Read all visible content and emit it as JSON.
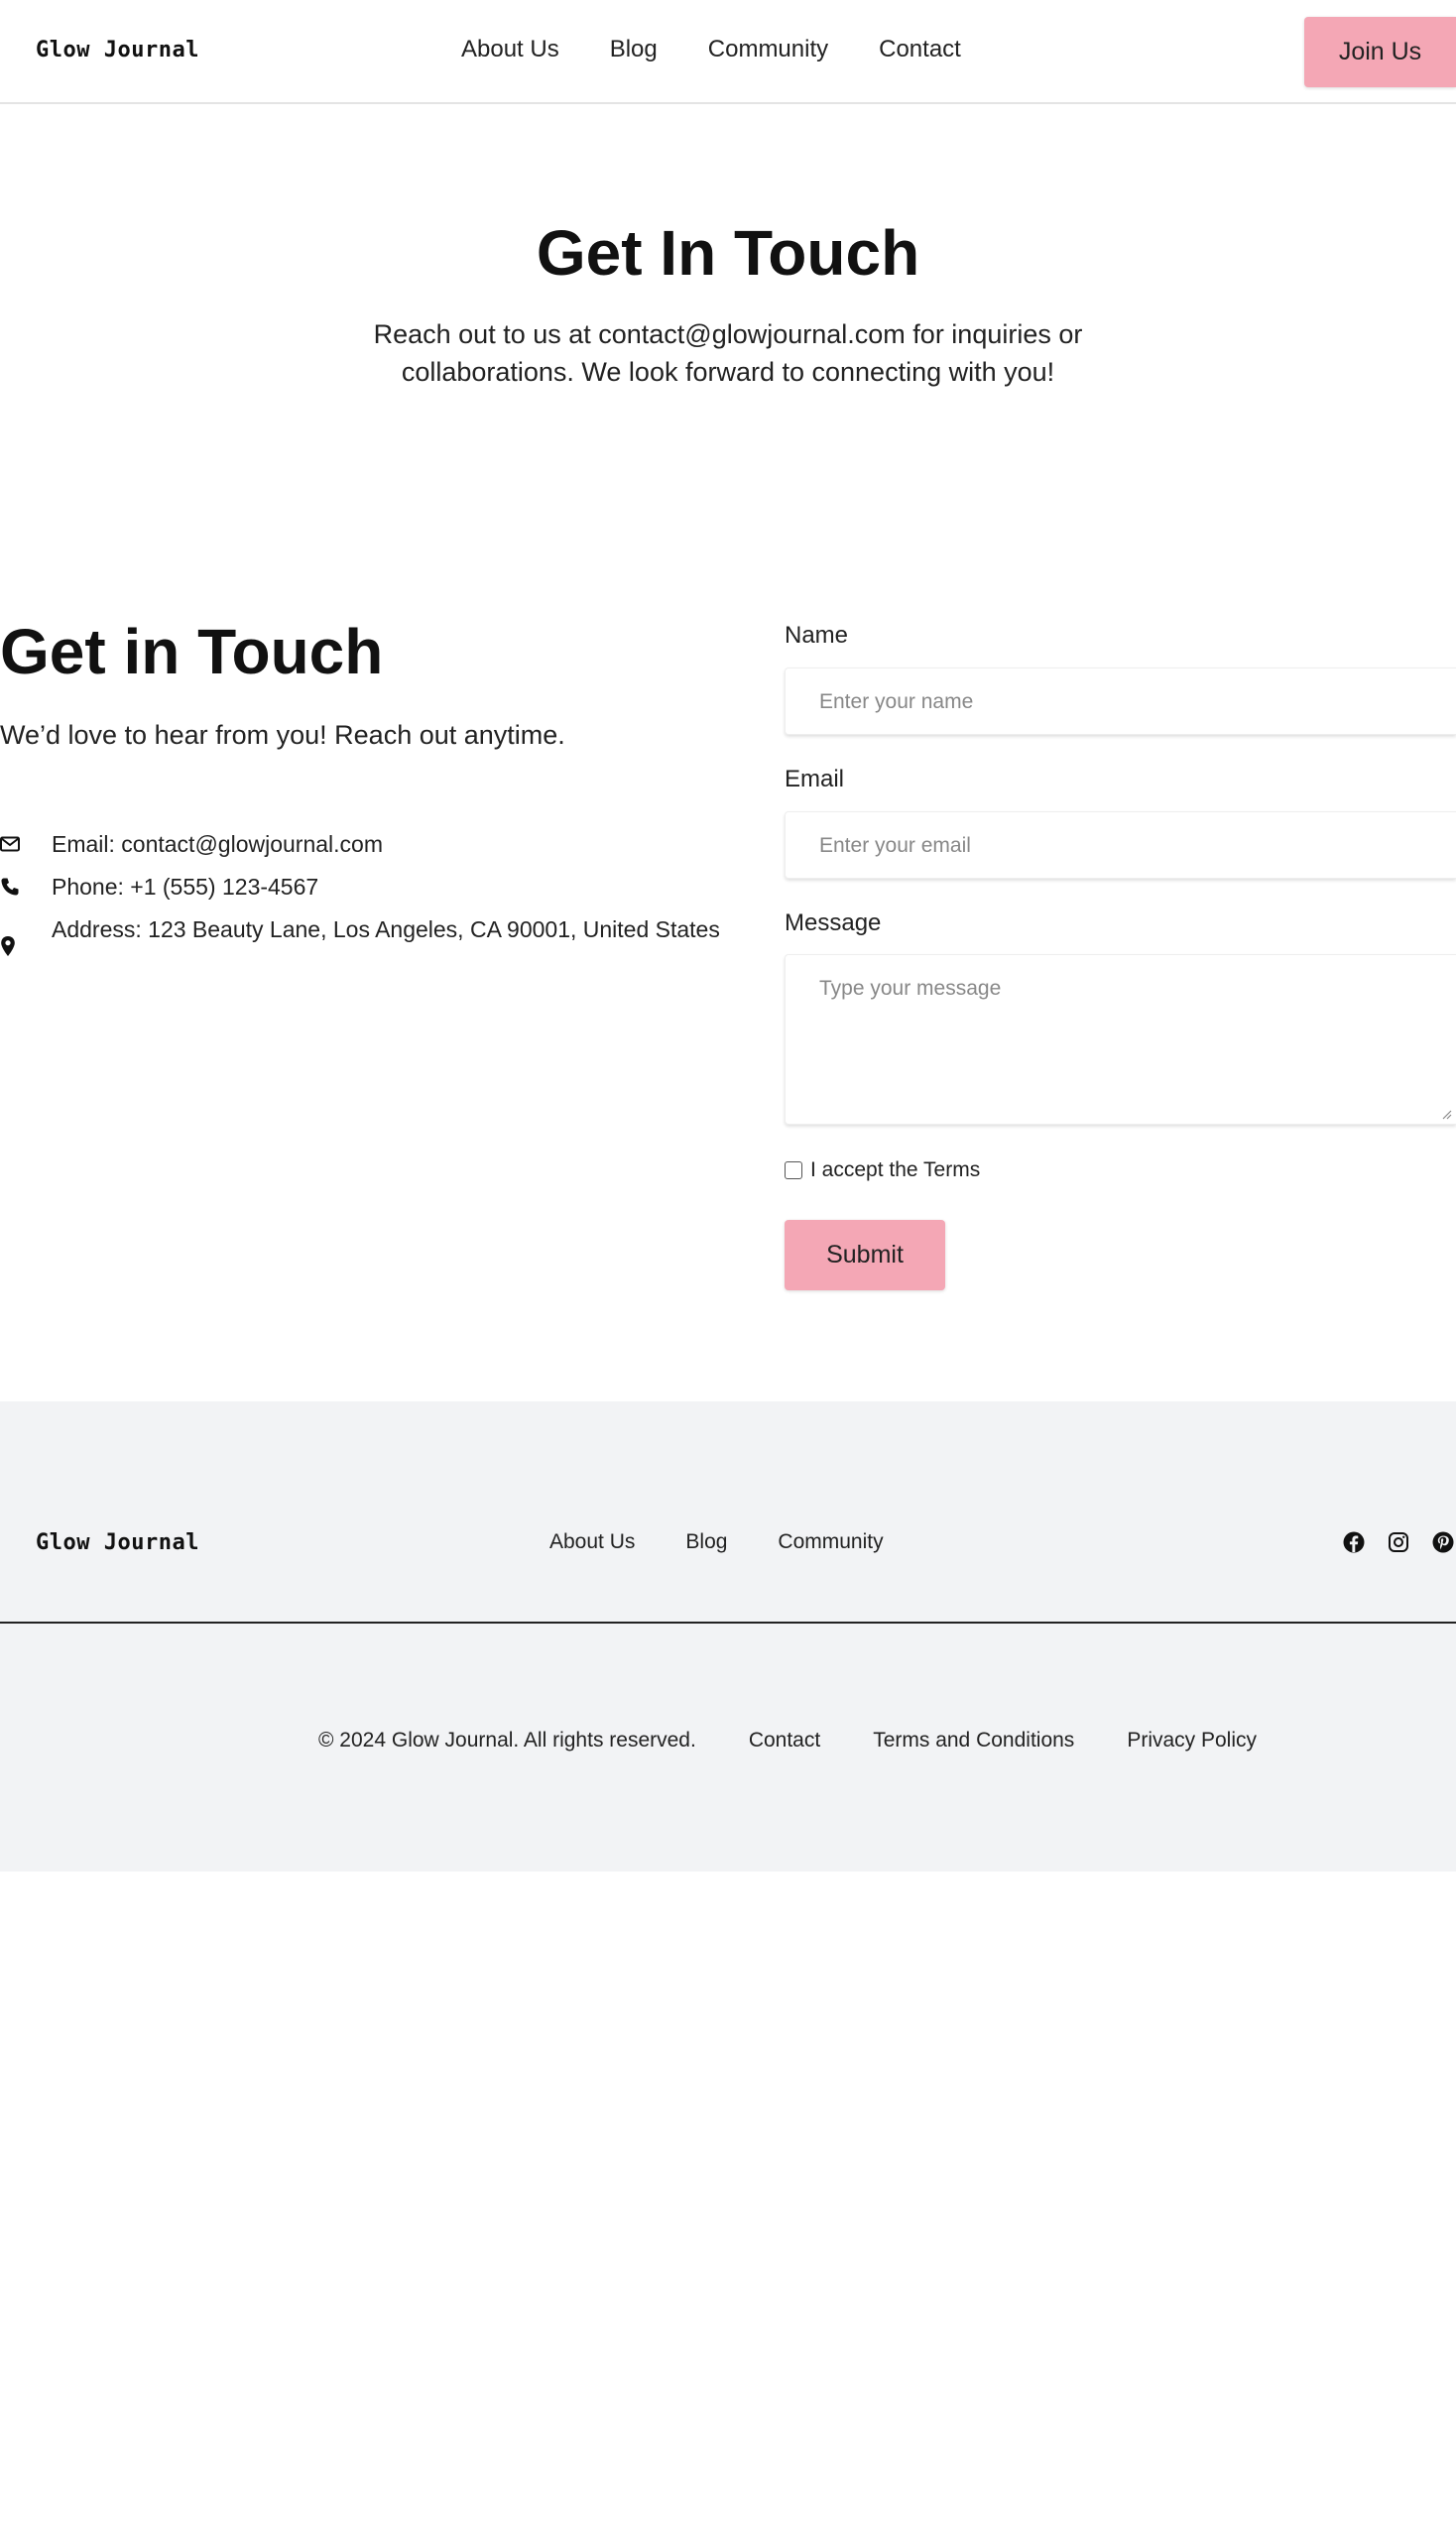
{
  "header": {
    "logo": "Glow Journal",
    "nav": [
      "About Us",
      "Blog",
      "Community",
      "Contact"
    ],
    "join_label": "Join Us"
  },
  "hero": {
    "title": "Get In Touch",
    "text": "Reach out to us at contact@glowjournal.com for inquiries or collaborations. We look forward to connecting with you!"
  },
  "contact": {
    "title": "Get in Touch",
    "subtitle": "We’d love to hear from you! Reach out anytime.",
    "info": [
      {
        "icon": "envelope-icon",
        "text": "Email: contact@glowjournal.com"
      },
      {
        "icon": "phone-icon",
        "text": "Phone: +1 (555) 123-4567"
      },
      {
        "icon": "map-pin-icon",
        "text": "Address: 123 Beauty Lane, Los Angeles, CA 90001, United States"
      }
    ]
  },
  "form": {
    "name_label": "Name",
    "name_placeholder": "Enter your name",
    "email_label": "Email",
    "email_placeholder": "Enter your email",
    "message_label": "Message",
    "message_placeholder": "Type your message",
    "terms_label": "I accept the Terms",
    "submit_label": "Submit"
  },
  "footer": {
    "logo": "Glow Journal",
    "nav": [
      "About Us",
      "Blog",
      "Community"
    ],
    "social": [
      "facebook-icon",
      "instagram-icon",
      "pinterest-icon"
    ],
    "copyright": "© 2024 Glow Journal. All rights reserved.",
    "links": [
      "Contact",
      "Terms and Conditions",
      "Privacy Policy"
    ]
  },
  "colors": {
    "accent": "#f4a7b5",
    "footer_bg": "#f2f3f5"
  }
}
